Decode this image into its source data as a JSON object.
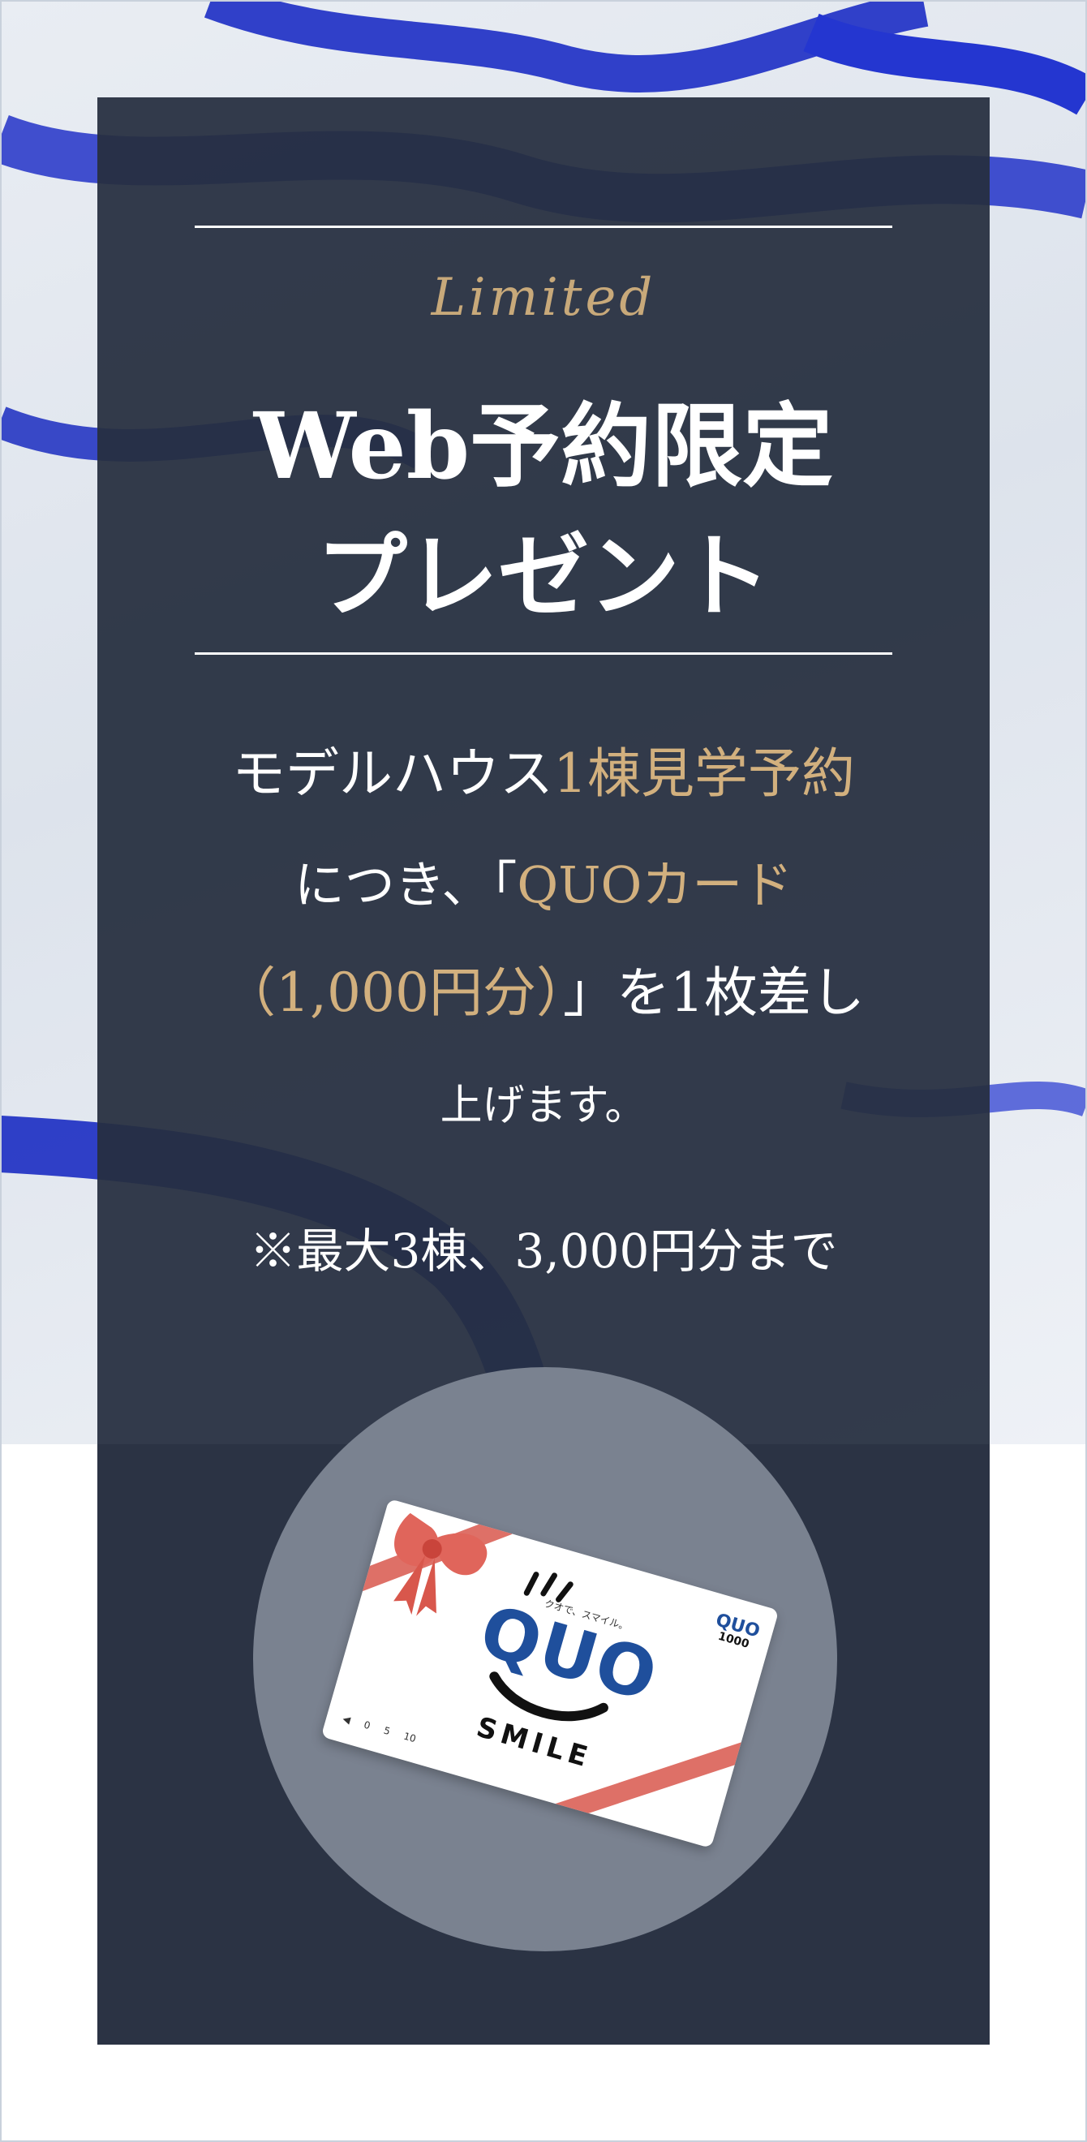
{
  "hero": {
    "eyebrow": "Limited",
    "title_line1": "Web予約限定",
    "title_line2": "プレゼント"
  },
  "offer": {
    "line1_a": "モデルハウス",
    "line1_b": "1棟見学予約",
    "line2_a": "につき、「",
    "line2_b": "QUOカード",
    "line3_a": "（1,000円分）",
    "line3_b": "」を1枚差し",
    "line4": "上げます。",
    "note": "※最大3棟、3,000円分まで"
  },
  "card": {
    "logo": "QUO",
    "tagline": "クオで、スマイル。",
    "smile": "SMILE",
    "brand": "QUO",
    "value": "1000",
    "ticks": "◀ 0 5 10"
  },
  "colors": {
    "panel": "#262f40",
    "accent_gold": "#d2b07e",
    "ribbon": "#1f2fb8"
  }
}
